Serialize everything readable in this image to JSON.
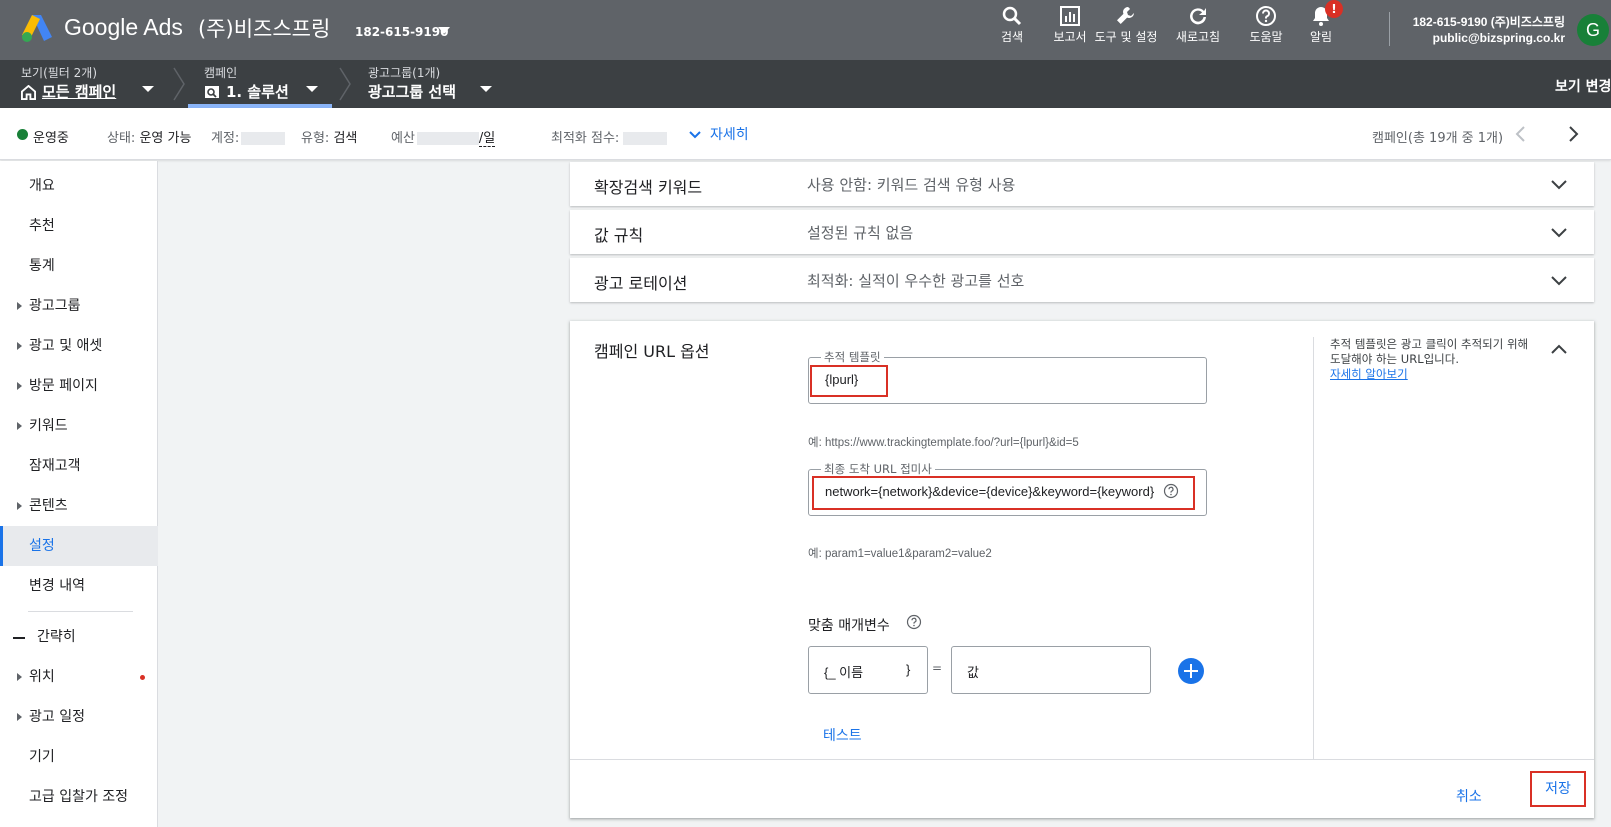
{
  "topbar": {
    "brand": "Google Ads",
    "account_name": "(주)비즈스프링",
    "account_id": "182-615-9190",
    "tools": [
      {
        "label": "검색",
        "icon": "search-icon"
      },
      {
        "label": "보고서",
        "icon": "reports-icon"
      },
      {
        "label": "도구 및 설정",
        "icon": "wrench-icon"
      },
      {
        "label": "새로고침",
        "icon": "refresh-icon"
      },
      {
        "label": "도움말",
        "icon": "help-icon"
      },
      {
        "label": "알림",
        "icon": "bell-icon",
        "badge": "!"
      }
    ],
    "account_line1": "182-615-9190 (주)비즈스프링",
    "account_email": "public@bizspring.co.kr",
    "avatar_letter": "G"
  },
  "breadcrumb": {
    "view": {
      "label": "보기(필터 2개)",
      "value": "모든 캠페인"
    },
    "campaign": {
      "label": "캠페인",
      "value": "1. 솔루션"
    },
    "adgroup": {
      "label": "광고그룹(1개)",
      "value": "광고그룹 선택"
    },
    "view_change": "보기 변경"
  },
  "status": {
    "state": "운영중",
    "status_label": "상태:",
    "status_value": "운영 가능",
    "account_label": "계정:",
    "type_label": "유형:",
    "type_value": "검색",
    "budget_label": "예산",
    "budget_suffix": "/일",
    "opt_label": "최적화 점수:",
    "details_link": "자세히",
    "pager_text": "캠페인(총 19개 중 1개)"
  },
  "sidebar": {
    "items": [
      {
        "label": "개요",
        "expandable": false
      },
      {
        "label": "추천",
        "expandable": false
      },
      {
        "label": "통계",
        "expandable": false
      },
      {
        "label": "광고그룹",
        "expandable": true
      },
      {
        "label": "광고 및 애셋",
        "expandable": true
      },
      {
        "label": "방문 페이지",
        "expandable": true
      },
      {
        "label": "키워드",
        "expandable": true
      },
      {
        "label": "잠재고객",
        "expandable": false
      },
      {
        "label": "콘텐츠",
        "expandable": true
      },
      {
        "label": "설정",
        "expandable": false,
        "active": true
      },
      {
        "label": "변경 내역",
        "expandable": false
      }
    ],
    "collapse_label": "간략히",
    "more_items": [
      {
        "label": "위치",
        "expandable": true,
        "alert": true
      },
      {
        "label": "광고 일정",
        "expandable": true
      },
      {
        "label": "기기",
        "expandable": false
      },
      {
        "label": "고급 입찰가 조정",
        "expandable": false
      }
    ]
  },
  "settings": {
    "rows": [
      {
        "title": "확장검색 키워드",
        "value": "사용 안함: 키워드 검색 유형 사용"
      },
      {
        "title": "값 규칙",
        "value": "설정된 규칙 없음"
      },
      {
        "title": "광고 로테이션",
        "value": "최적화: 실적이 우수한 광고를 선호"
      }
    ],
    "url_options": {
      "title": "캠페인 URL 옵션",
      "tracking_label": "추적 템플릿",
      "tracking_value": "{lpurl}",
      "tracking_example": "예: https://www.trackingtemplate.foo/?url={lpurl}&id=5",
      "suffix_label": "최종 도착 URL 접미사",
      "suffix_value": "network={network}&device={device}&keyword={keyword}",
      "suffix_example": "예: param1=value1&param2=value2",
      "custom_params_label": "맞춤 매개변수",
      "param_name_placeholder_open": "{_ 이름",
      "param_name_placeholder_close": "}",
      "param_equals": "=",
      "param_value_placeholder": "값",
      "test_link": "테스트",
      "help_text": "추적 템플릿은 광고 클릭이 추적되기 위해 도달해야 하는 URL입니다.",
      "help_link": "자세히 알아보기",
      "cancel": "취소",
      "save": "저장"
    }
  },
  "colors": {
    "topbar": "#5f6368",
    "crumbbar": "#3c4043",
    "accent": "#1a73e8",
    "highlight": "#d93025",
    "status_ok": "#188038"
  }
}
